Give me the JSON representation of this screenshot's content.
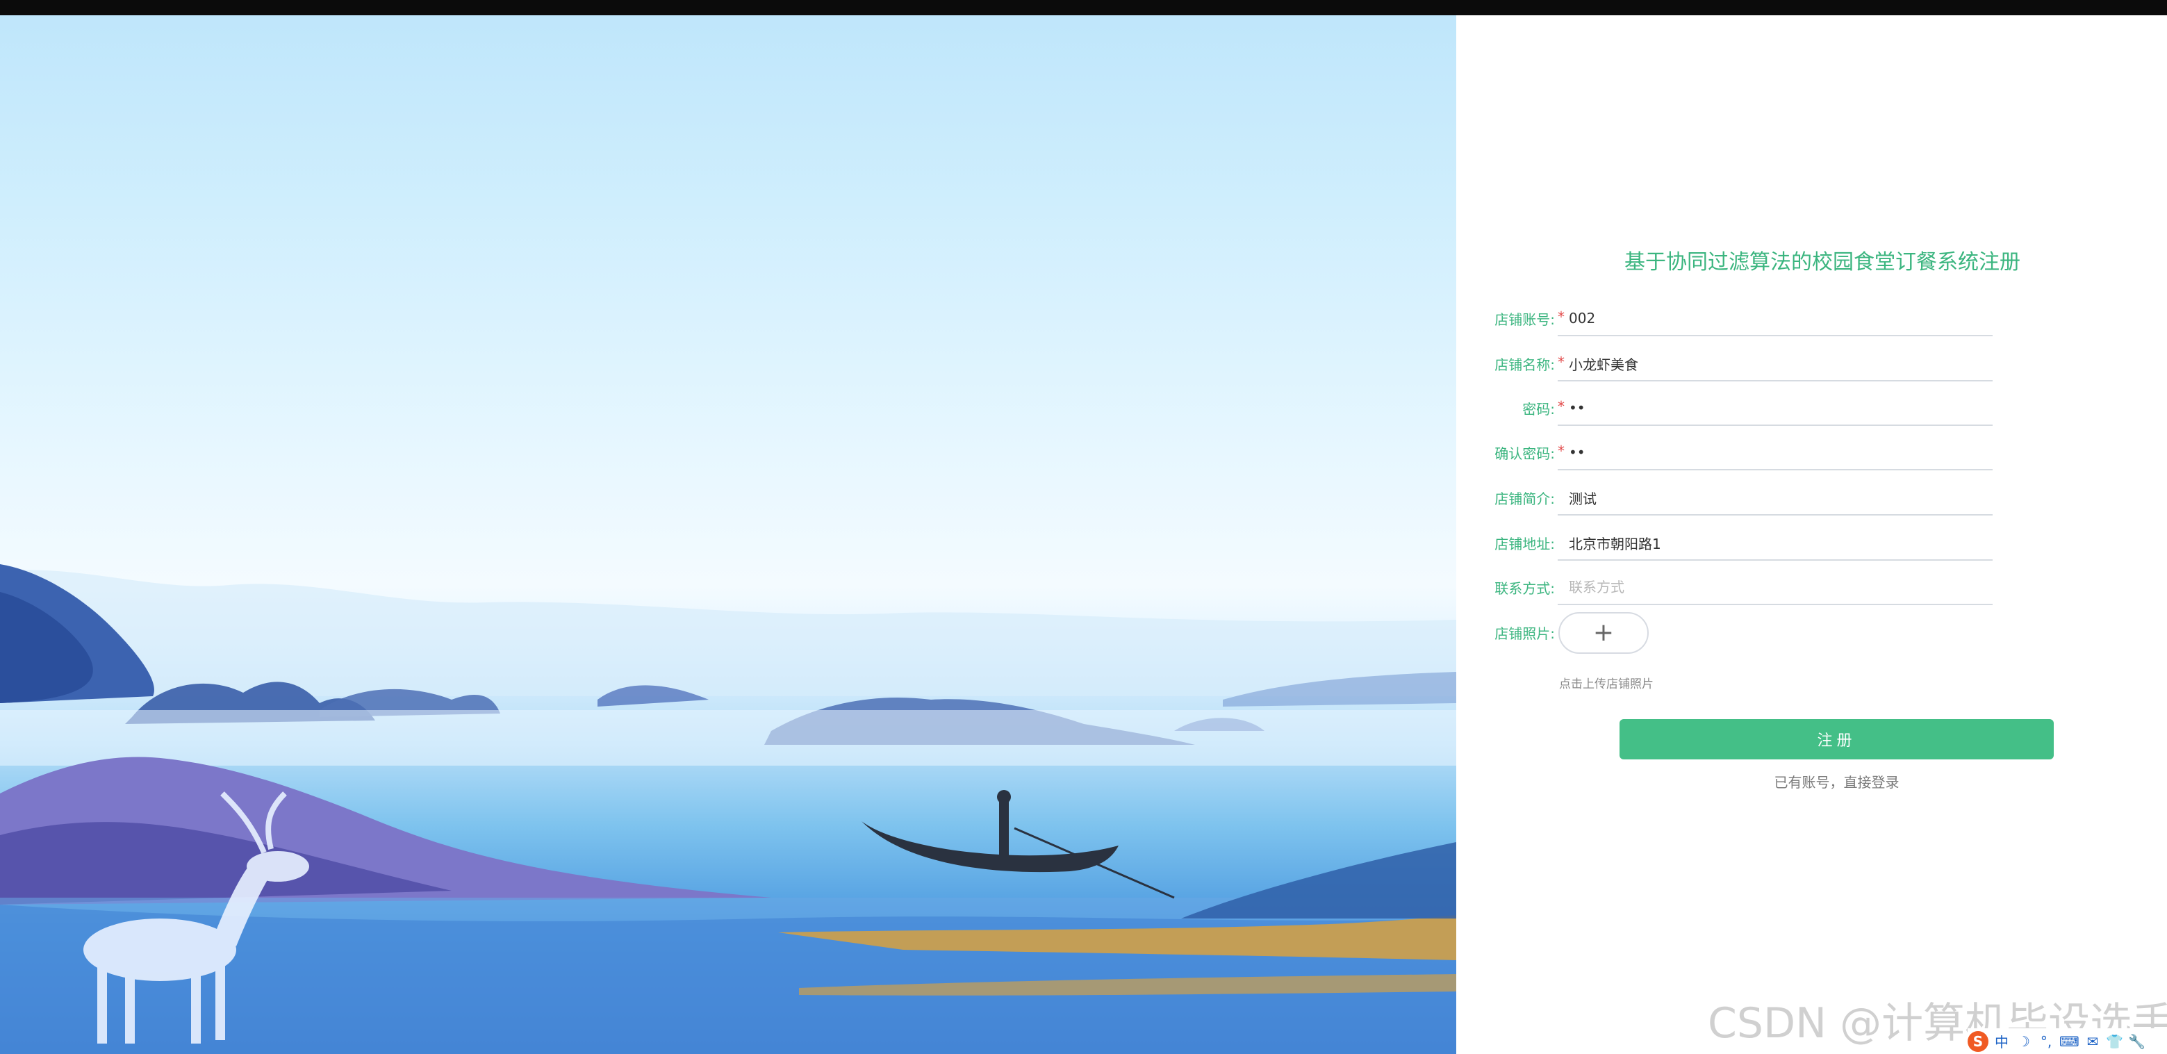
{
  "form": {
    "title": "基于协同过滤算法的校园食堂订餐系统注册",
    "fields": [
      {
        "label": "店铺账号:",
        "required": true,
        "value": "002",
        "placeholder": "",
        "type": "text"
      },
      {
        "label": "店铺名称:",
        "required": true,
        "value": "小龙虾美食",
        "placeholder": "",
        "type": "text"
      },
      {
        "label": "密码:",
        "required": true,
        "value": "••",
        "placeholder": "",
        "type": "text"
      },
      {
        "label": "确认密码:",
        "required": true,
        "value": "••",
        "placeholder": "",
        "type": "text"
      },
      {
        "label": "店铺简介:",
        "required": false,
        "value": "测试",
        "placeholder": "",
        "type": "text"
      },
      {
        "label": "店铺地址:",
        "required": false,
        "value": "北京市朝阳路1",
        "placeholder": "",
        "type": "text"
      },
      {
        "label": "联系方式:",
        "required": false,
        "value": "",
        "placeholder": "联系方式",
        "type": "text"
      }
    ],
    "photo": {
      "label": "店铺照片:",
      "add_symbol": "+",
      "tip": "点击上传店铺照片"
    },
    "required_mark": "*",
    "submit_label": "注册",
    "login_link": "已有账号，直接登录"
  },
  "watermark": "CSDN @计算机毕设选手",
  "tray": {
    "icons": [
      {
        "name": "sogou-icon",
        "glyph": "S"
      },
      {
        "name": "ime-chinese-icon",
        "glyph": "中"
      },
      {
        "name": "moon-icon",
        "glyph": "☽"
      },
      {
        "name": "punctuation-icon",
        "glyph": "°,"
      },
      {
        "name": "keyboard-icon",
        "glyph": "⌨"
      },
      {
        "name": "tools-icon",
        "glyph": "✉"
      },
      {
        "name": "shirt-icon",
        "glyph": "👕"
      },
      {
        "name": "wrench-icon",
        "glyph": "🔧"
      }
    ]
  },
  "colors": {
    "accent": "#44bf87",
    "label": "#3bb57f",
    "required": "#e24a4a"
  }
}
